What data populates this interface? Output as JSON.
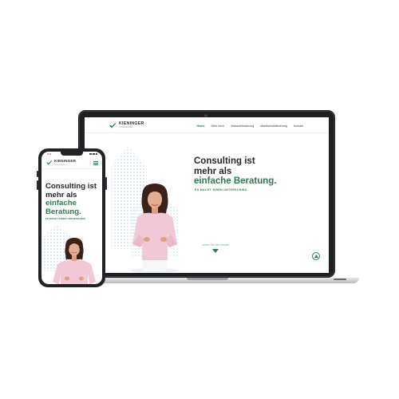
{
  "brand": {
    "name": "KIENINGER",
    "tagline": "CONSULTING",
    "accent_color": "#2e7a57",
    "text_color": "#24282d",
    "logo_icon": "check-leaf-icon"
  },
  "desktop": {
    "nav": [
      {
        "label": "Home",
        "active": true
      },
      {
        "label": "Über mich",
        "active": false
      },
      {
        "label": "Verkaufsförderung",
        "active": false
      },
      {
        "label": "Marktsensibilisierung",
        "active": false
      },
      {
        "label": "Kontakt",
        "active": false
      }
    ],
    "hero": {
      "line1": "Consulting ist",
      "line2": "mehr als",
      "highlight": "einfache Beratung.",
      "subtitle": "ES MACHT EINEN UNTERSCHIED.",
      "more_link": "Lernen Sie mich kennen",
      "scroll_icon": "chevron-down-icon",
      "scroll_top_icon": "arrow-up-icon"
    }
  },
  "mobile": {
    "status_time": "9:41",
    "menu_icon": "hamburger-menu-icon",
    "hero": {
      "line1": "Consulting ist",
      "line2": "mehr als",
      "highlight": "einfache",
      "line4": "Beratung.",
      "subtitle": "ES MACHT EINEN UNTERSCHIED."
    }
  }
}
